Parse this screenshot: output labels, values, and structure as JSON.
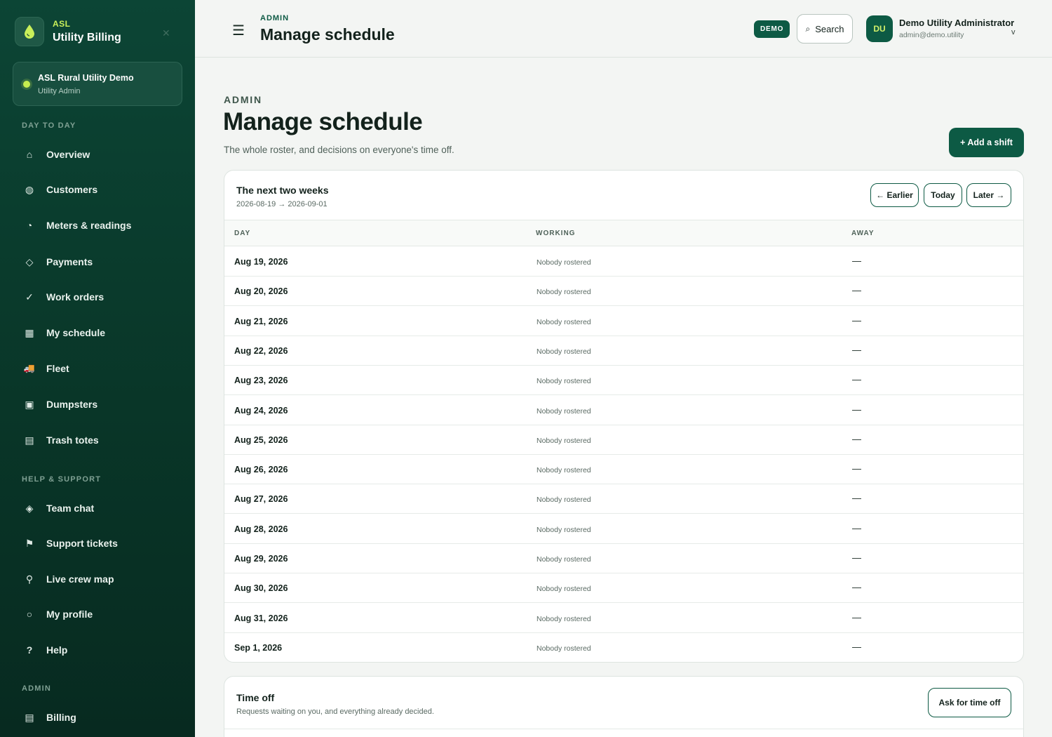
{
  "brand": {
    "small": "ASL",
    "name": "Utility Billing"
  },
  "org": {
    "name": "ASL Rural Utility Demo",
    "role": "Utility Admin"
  },
  "sidebar": {
    "section_day": "DAY TO DAY",
    "section_help": "HELP & SUPPORT",
    "section_admin": "ADMIN",
    "items": [
      {
        "label": "Overview",
        "icon": "home-icon",
        "glyph": "⌂"
      },
      {
        "label": "Customers",
        "icon": "customers-icon",
        "glyph": "◍"
      },
      {
        "label": "Meters & readings",
        "icon": "meter-icon",
        "glyph": "◔"
      },
      {
        "label": "Payments",
        "icon": "payments-icon",
        "glyph": "◇"
      },
      {
        "label": "Work orders",
        "icon": "checkmark-icon",
        "glyph": "✓"
      },
      {
        "label": "My schedule",
        "icon": "calendar-icon",
        "glyph": "▦"
      },
      {
        "label": "Fleet",
        "icon": "truck-icon",
        "glyph": "🚚"
      },
      {
        "label": "Dumpsters",
        "icon": "dumpster-icon",
        "glyph": "▣"
      },
      {
        "label": "Trash totes",
        "icon": "tote-icon",
        "glyph": "▤"
      },
      {
        "label": "Team chat",
        "icon": "chat-icon",
        "glyph": "◈"
      },
      {
        "label": "Support tickets",
        "icon": "flag-icon",
        "glyph": "⚑"
      },
      {
        "label": "Live crew map",
        "icon": "map-pin-icon",
        "glyph": "⚲"
      },
      {
        "label": "My profile",
        "icon": "profile-icon",
        "glyph": "○"
      },
      {
        "label": "Help",
        "icon": "help-icon",
        "glyph": "?"
      },
      {
        "label": "Billing",
        "icon": "billing-icon",
        "glyph": "▤"
      }
    ]
  },
  "header": {
    "eyebrow": "ADMIN",
    "title": "Manage schedule",
    "demo_badge": "DEMO",
    "search_label": "Search",
    "avatar_initials": "DU",
    "user_name": "Demo Utility Administrator",
    "user_email": "admin@demo.utility",
    "caret": "v"
  },
  "page": {
    "eyebrow": "ADMIN",
    "title": "Manage schedule",
    "subtitle": "The whole roster, and decisions on everyone's time off.",
    "add_shift": "+ Add a shift"
  },
  "roster": {
    "title": "The next two weeks",
    "range": "2026-08-19 → 2026-09-01",
    "btn_earlier": "← Earlier",
    "btn_today": "Today",
    "btn_later": "Later →",
    "columns": [
      "DAY",
      "WORKING",
      "AWAY"
    ],
    "rows": [
      {
        "day": "Aug 19, 2026",
        "working": "Nobody rostered",
        "away": "—"
      },
      {
        "day": "Aug 20, 2026",
        "working": "Nobody rostered",
        "away": "—"
      },
      {
        "day": "Aug 21, 2026",
        "working": "Nobody rostered",
        "away": "—"
      },
      {
        "day": "Aug 22, 2026",
        "working": "Nobody rostered",
        "away": "—"
      },
      {
        "day": "Aug 23, 2026",
        "working": "Nobody rostered",
        "away": "—"
      },
      {
        "day": "Aug 24, 2026",
        "working": "Nobody rostered",
        "away": "—"
      },
      {
        "day": "Aug 25, 2026",
        "working": "Nobody rostered",
        "away": "—"
      },
      {
        "day": "Aug 26, 2026",
        "working": "Nobody rostered",
        "away": "—"
      },
      {
        "day": "Aug 27, 2026",
        "working": "Nobody rostered",
        "away": "—"
      },
      {
        "day": "Aug 28, 2026",
        "working": "Nobody rostered",
        "away": "—"
      },
      {
        "day": "Aug 29, 2026",
        "working": "Nobody rostered",
        "away": "—"
      },
      {
        "day": "Aug 30, 2026",
        "working": "Nobody rostered",
        "away": "—"
      },
      {
        "day": "Aug 31, 2026",
        "working": "Nobody rostered",
        "away": "—"
      },
      {
        "day": "Sep 1, 2026",
        "working": "Nobody rostered",
        "away": "—"
      }
    ]
  },
  "timeoff": {
    "title": "Time off",
    "subtitle": "Requests waiting on you, and everything already decided.",
    "ask_button": "Ask for time off"
  },
  "colors": {
    "sidebar": "#0c4535",
    "accent": "#0d5a44",
    "lime": "#c6ec4f"
  }
}
